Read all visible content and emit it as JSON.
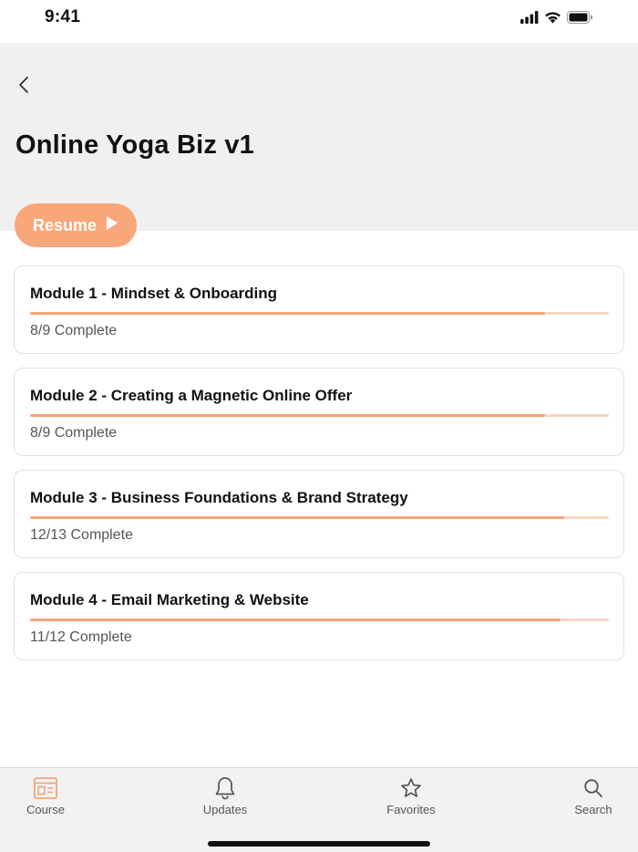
{
  "status_bar": {
    "time": "9:41"
  },
  "header": {
    "title": "Online Yoga Biz v1",
    "resume_label": "Resume"
  },
  "colors": {
    "accent": "#f9a77a",
    "progress": "#f5a57a",
    "header_bg": "#f0f0f0"
  },
  "modules": [
    {
      "title": "Module 1 - Mindset & Onboarding",
      "status": "8/9 Complete",
      "progress": 0.889
    },
    {
      "title": "Module 2 - Creating a Magnetic Online Offer",
      "status": "8/9 Complete",
      "progress": 0.889
    },
    {
      "title": "Module 3 - Business Foundations & Brand Strategy",
      "status": "12/13 Complete",
      "progress": 0.923
    },
    {
      "title": "Module 4 - Email Marketing & Website",
      "status": "11/12 Complete",
      "progress": 0.917
    }
  ],
  "tabs": [
    {
      "label": "Course",
      "icon": "course-icon",
      "active": true
    },
    {
      "label": "Updates",
      "icon": "bell-icon",
      "active": false
    },
    {
      "label": "Favorites",
      "icon": "star-icon",
      "active": false
    },
    {
      "label": "Search",
      "icon": "search-icon",
      "active": false
    }
  ]
}
